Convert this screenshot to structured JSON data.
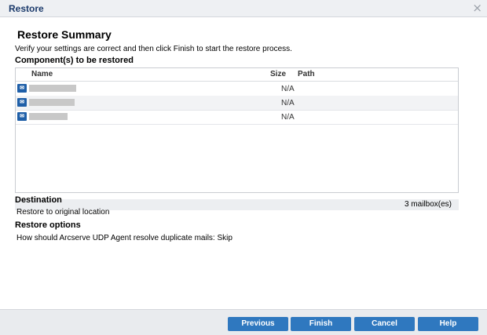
{
  "window": {
    "title": "Restore",
    "close_glyph": "×"
  },
  "page": {
    "heading": "Restore Summary",
    "instruction": "Verify your settings are correct and then click Finish to start the restore process."
  },
  "components": {
    "label": "Component(s) to be restored",
    "columns": {
      "name": "Name",
      "size": "Size",
      "path": "Path"
    },
    "rows": [
      {
        "icon": "mailbox-icon",
        "name_redacted": true,
        "size": "N/A",
        "path": ""
      },
      {
        "icon": "mailbox-icon",
        "name_redacted": true,
        "size": "N/A",
        "path": ""
      },
      {
        "icon": "mailbox-icon",
        "name_redacted": true,
        "size": "N/A",
        "path": ""
      }
    ],
    "count_text": "3 mailbox(es)"
  },
  "destination": {
    "label": "Destination",
    "value": "Restore to original location"
  },
  "restore_options": {
    "label": "Restore options",
    "value": "How should Arcserve UDP Agent resolve duplicate mails: Skip"
  },
  "buttons": {
    "previous": "Previous",
    "finish": "Finish",
    "cancel": "Cancel",
    "help": "Help"
  },
  "colors": {
    "button": "#2f78bf",
    "title_text": "#1b3a6b",
    "row_alt": "#f2f3f5"
  }
}
